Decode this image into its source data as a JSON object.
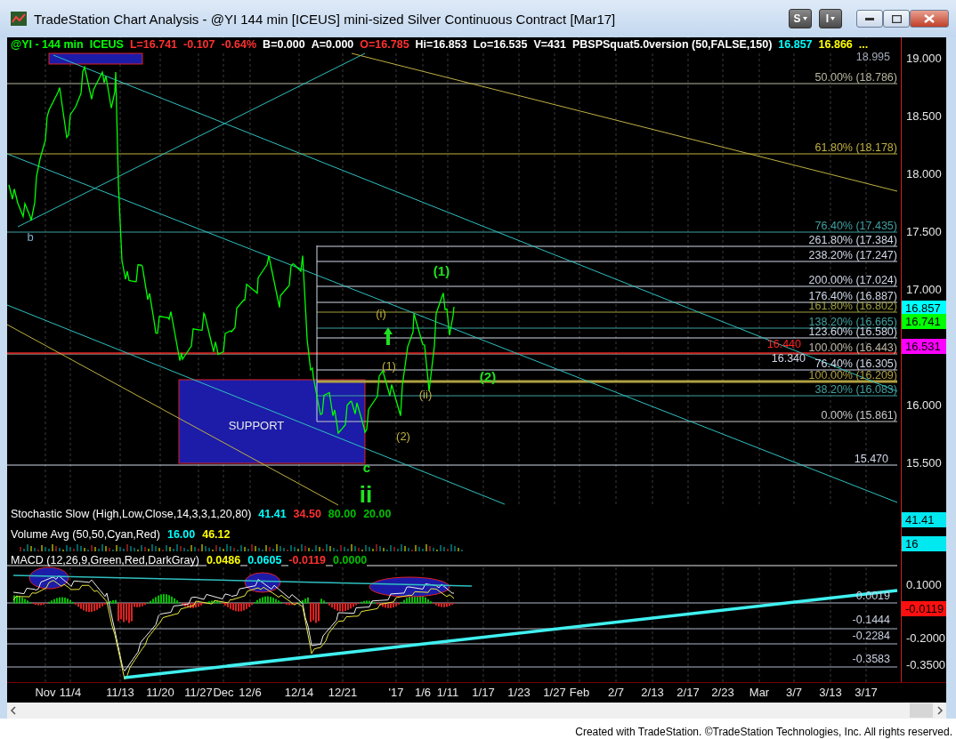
{
  "window": {
    "title": "TradeStation Chart Analysis - @YI 144 min [ICEUS] mini-sized Silver Continuous Contract [Mar17]",
    "menu_buttons": [
      "S",
      "I"
    ]
  },
  "header": [
    {
      "text": "@YI - 144 min",
      "color": "#00ff00"
    },
    {
      "text": "ICEUS",
      "color": "#00ff00"
    },
    {
      "text": "L=16.741",
      "color": "#ff3030"
    },
    {
      "text": "-0.107",
      "color": "#ff3030"
    },
    {
      "text": "-0.64%",
      "color": "#ff3030"
    },
    {
      "text": "B=0.000",
      "color": "#ffffff"
    },
    {
      "text": "A=0.000",
      "color": "#ffffff"
    },
    {
      "text": "O=16.785",
      "color": "#ff3030"
    },
    {
      "text": "Hi=16.853",
      "color": "#ffffff"
    },
    {
      "text": "Lo=16.535",
      "color": "#ffffff"
    },
    {
      "text": "V=431",
      "color": "#ffffff"
    },
    {
      "text": "PBSPSquat5.0version (50,FALSE,150)",
      "color": "#ffffff"
    },
    {
      "text": "16.857",
      "color": "#00ffff"
    },
    {
      "text": "16.866",
      "color": "#ffff00"
    },
    {
      "text": "...",
      "color": "#ffff00"
    }
  ],
  "price_pane": {
    "axis_labels": [
      "19.000",
      "18.500",
      "18.000",
      "17.500",
      "17.000",
      "16.000",
      "15.500"
    ],
    "badges": [
      {
        "text": "16.857",
        "color": "#00ffff"
      },
      {
        "text": "16.741",
        "color": "#00ff00"
      },
      {
        "text": "16.531",
        "color": "#ff00ff"
      }
    ],
    "fib_levels": [
      {
        "text": "18.995",
        "color": "#a0a8b8"
      },
      {
        "text": "50.00% (18.786)",
        "color": "#b8b8a0"
      },
      {
        "text": "61.80% (18.178)",
        "color": "#c0b040"
      },
      {
        "text": "76.40% (17.435)",
        "color": "#40a0a0"
      },
      {
        "text": "261.80% (17.384)",
        "color": "#d0d8e8"
      },
      {
        "text": "238.20% (17.247)",
        "color": "#d0d8e8"
      },
      {
        "text": "200.00% (17.024)",
        "color": "#d0d8e8"
      },
      {
        "text": "176.40% (16.887)",
        "color": "#d0d8e8"
      },
      {
        "text": "161.80% (16.802)",
        "color": "#a0a040"
      },
      {
        "text": "138.20% (16.665)",
        "color": "#40a0a0"
      },
      {
        "text": "123.60% (16.580)",
        "color": "#d0d8e8"
      },
      {
        "text": "16.440",
        "color": "#ff2020"
      },
      {
        "text": "100.00% (16.443)",
        "color": "#c0b8a8"
      },
      {
        "text": "16.340",
        "color": "#d0d8e8"
      },
      {
        "text": "76.40% (16.305)",
        "color": "#d0d8e8"
      },
      {
        "text": "100.00% (16.209)",
        "color": "#b0a040"
      },
      {
        "text": "38.20% (16.083)",
        "color": "#40a0a0"
      },
      {
        "text": "0.00% (15.861)",
        "color": "#c8c8c8"
      },
      {
        "text": "15.470",
        "color": "#d0d8e8"
      }
    ],
    "support_label": "SUPPORT",
    "wave_labels": [
      {
        "text": "(1)",
        "color": "#20e020",
        "kind": "large"
      },
      {
        "text": "(2)",
        "color": "#20e020",
        "kind": "large"
      },
      {
        "text": "ii",
        "color": "#20e020",
        "kind": "huge"
      },
      {
        "text": "c",
        "color": "#20e020",
        "kind": "large"
      },
      {
        "text": "b",
        "color": "#80b0d0",
        "kind": "small"
      },
      {
        "text": "(i)",
        "color": "#c0b040",
        "kind": "small"
      },
      {
        "text": "(1)",
        "color": "#c0b040",
        "kind": "small"
      },
      {
        "text": "(2)",
        "color": "#c0b040",
        "kind": "small"
      },
      {
        "text": "(ii)",
        "color": "#c0b040",
        "kind": "small"
      }
    ]
  },
  "stochastic_pane": {
    "title": "Stochastic Slow (High,Low,Close,14,3,3,1,20,80)",
    "values": [
      {
        "text": "41.41",
        "color": "#00ffff"
      },
      {
        "text": "34.50",
        "color": "#ff3030"
      },
      {
        "text": "80.00",
        "color": "#00c000"
      },
      {
        "text": "20.00",
        "color": "#00c000"
      }
    ],
    "badge": "41.41"
  },
  "volume_pane": {
    "title": "Volume Avg (50,50,Cyan,Red)",
    "values": [
      {
        "text": "16.00",
        "color": "#00ffff"
      },
      {
        "text": "46.12",
        "color": "#ffff00"
      }
    ],
    "badge": "16"
  },
  "macd_pane": {
    "title": "MACD (12,26,9,Green,Red,DarkGray)",
    "values": [
      {
        "text": "0.0486",
        "color": "#ffff00"
      },
      {
        "text": "0.0605",
        "color": "#00ffff"
      },
      {
        "text": "-0.0119",
        "color": "#ff3030"
      },
      {
        "text": "0.0000",
        "color": "#00c000"
      }
    ],
    "axis_labels": [
      "0.1000",
      "-0.2000",
      "-0.3500"
    ],
    "badge": "-0.0119",
    "levels": [
      "0.0019",
      "-0.1444",
      "-0.2284",
      "-0.3583"
    ]
  },
  "x_axis": {
    "labels": [
      "Nov",
      "11/4",
      "11/13",
      "11/20",
      "11/27",
      "Dec",
      "12/6",
      "12/14",
      "12/21",
      "'17",
      "1/6",
      "1/11",
      "1/17",
      "1/23",
      "1/27",
      "Feb",
      "2/7",
      "2/13",
      "2/17",
      "2/23",
      "Mar",
      "3/7",
      "3/13",
      "3/17"
    ]
  },
  "footer": "Created with TradeStation. ©TradeStation Technologies, Inc. All rights reserved."
}
